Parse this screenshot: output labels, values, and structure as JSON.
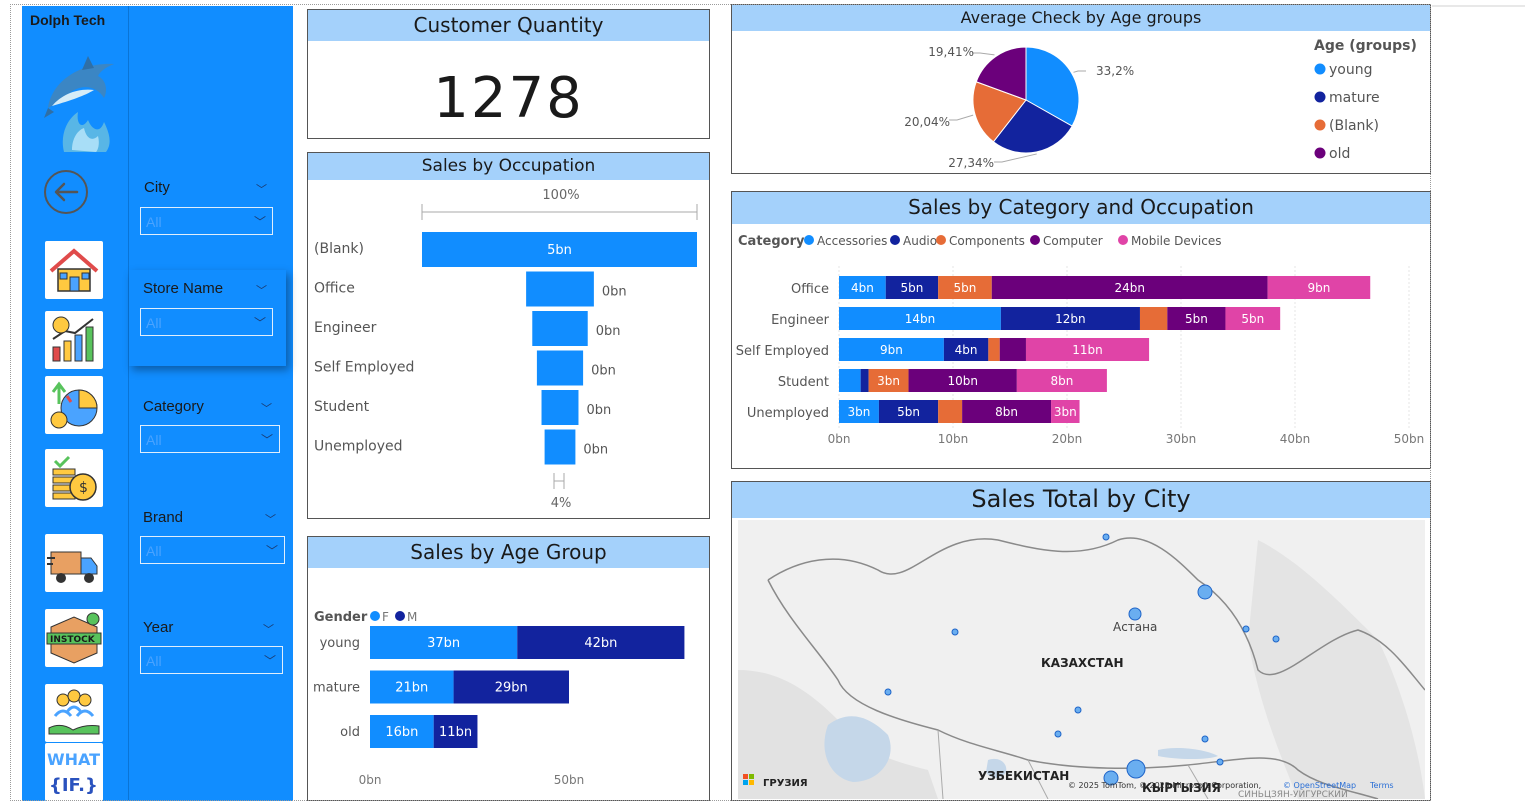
{
  "sidebar": {
    "brand": "Dolph Tech",
    "nav_icons": [
      "home-icon",
      "sales-chart-icon",
      "pie-chart-icon",
      "coins-icon",
      "delivery-truck-icon",
      "instock-box-icon",
      "customers-icon",
      "what-if-icon"
    ],
    "instock_text": "INSTOCK",
    "whatif_line1": "WHAT",
    "whatif_line2": "{IF.}"
  },
  "filters": [
    {
      "label": "City",
      "value": "All"
    },
    {
      "label": "Store Name",
      "value": "All"
    },
    {
      "label": "Category",
      "value": "All"
    },
    {
      "label": "Brand",
      "value": "All"
    },
    {
      "label": "Year",
      "value": "All"
    }
  ],
  "customer_quantity": {
    "title": "Customer Quantity",
    "value": "1278"
  },
  "sales_by_occupation": {
    "title": "Sales by Occupation",
    "top_label": "100%",
    "bottom_label": "4%"
  },
  "sales_by_age_group": {
    "title": "Sales by Age Group",
    "legend_title": "Gender"
  },
  "avg_check": {
    "title": "Average Check by Age groups",
    "legend_title": "Age (groups)"
  },
  "sales_cat_occ": {
    "title": "Sales by Category and Occupation",
    "legend_title": "Category"
  },
  "sales_city": {
    "title": "Sales Total by City",
    "labels": {
      "astana": "Астана",
      "kazakhstan": "КАЗАХСТАН",
      "uzbekistan": "УЗБЕКИСТАН",
      "georgia": "ГРУЗИЯ",
      "xinjiang": "СИНЬЦЗЯН-УЙГУРСКИЙ",
      "kyrgyzstan": "КЫРГЫЗИЯ"
    },
    "attribution": "© 2025 TomTom, © 2025 Microsoft Corporation,",
    "osm": "© OpenStreetMap",
    "terms": "Terms",
    "bubble_count": 13
  },
  "colors": {
    "accent_blue": "#118dff",
    "dark_blue": "#12239e",
    "orange": "#e66c37",
    "purple": "#6b007b",
    "pink": "#e044a7",
    "title_band": "#a4d1fb"
  },
  "chart_data": [
    {
      "type": "bar",
      "orientation": "horizontal",
      "title": "Sales by Occupation",
      "categories": [
        "(Blank)",
        "Office",
        "Engineer",
        "Self Employed",
        "Student",
        "Unemployed"
      ],
      "values": [
        5,
        0.44,
        0.36,
        0.3,
        0.24,
        0.2
      ],
      "data_labels": [
        "5bn",
        "0bn",
        "0bn",
        "0bn",
        "0bn",
        "0bn"
      ],
      "unit": "bn",
      "scale_labels": {
        "max": "100%",
        "min": "4%"
      }
    },
    {
      "type": "bar",
      "orientation": "horizontal",
      "stacked": true,
      "title": "Sales by Age Group",
      "legend_title": "Gender",
      "categories": [
        "young",
        "mature",
        "old"
      ],
      "series": [
        {
          "name": "F",
          "color": "#118dff",
          "values": [
            37,
            21,
            16
          ],
          "labels": [
            "37bn",
            "21bn",
            "16bn"
          ]
        },
        {
          "name": "M",
          "color": "#12239e",
          "values": [
            42,
            29,
            11
          ],
          "labels": [
            "42bn",
            "29bn",
            "11bn"
          ]
        }
      ],
      "ticks": [
        "0bn",
        "50bn"
      ],
      "xlim": [
        0,
        80
      ]
    },
    {
      "type": "pie",
      "title": "Average Check by Age groups",
      "legend_title": "Age (groups)",
      "categories": [
        "young",
        "mature",
        "(Blank)",
        "old"
      ],
      "values": [
        33.2,
        27.34,
        20.04,
        19.41
      ],
      "labels": [
        "33,2%",
        "27,34%",
        "20,04%",
        "19,41%"
      ],
      "colors": [
        "#118dff",
        "#12239e",
        "#e66c37",
        "#6b007b"
      ],
      "legend_position": "right"
    },
    {
      "type": "bar",
      "orientation": "horizontal",
      "stacked": true,
      "title": "Sales by Category and Occupation",
      "legend_title": "Category",
      "legend_position": "top-left",
      "categories": [
        "Office",
        "Engineer",
        "Self Employed",
        "Student",
        "Unemployed"
      ],
      "series": [
        {
          "name": "Accessories",
          "color": "#118dff",
          "values": [
            4.1,
            14.2,
            9.2,
            1.9,
            3.5
          ],
          "labels": [
            "4bn",
            "14bn",
            "9bn",
            "",
            "3bn"
          ]
        },
        {
          "name": "Audio",
          "color": "#12239e",
          "values": [
            4.6,
            12.2,
            3.9,
            0.7,
            5.2
          ],
          "labels": [
            "5bn",
            "12bn",
            "4bn",
            "",
            "5bn"
          ]
        },
        {
          "name": "Components",
          "color": "#e66c37",
          "values": [
            4.7,
            2.4,
            1.0,
            3.5,
            2.1
          ],
          "labels": [
            "5bn",
            "",
            "",
            "3bn",
            ""
          ]
        },
        {
          "name": "Computer",
          "color": "#6b007b",
          "values": [
            24.2,
            5.1,
            2.3,
            9.5,
            7.8
          ],
          "labels": [
            "24bn",
            "5bn",
            "",
            "10bn",
            "8bn"
          ]
        },
        {
          "name": "Mobile Devices",
          "color": "#e044a7",
          "values": [
            9.0,
            4.8,
            10.8,
            7.9,
            2.5
          ],
          "labels": [
            "9bn",
            "5bn",
            "11bn",
            "8bn",
            "3bn"
          ]
        }
      ],
      "ticks": [
        "0bn",
        "10bn",
        "20bn",
        "30bn",
        "40bn",
        "50bn"
      ],
      "xlim": [
        0,
        50
      ],
      "grid": true
    }
  ]
}
